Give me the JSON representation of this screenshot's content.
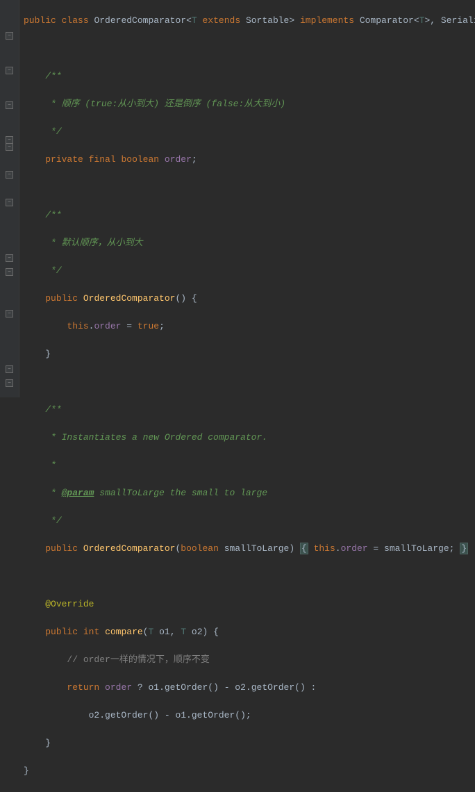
{
  "code": {
    "line1_public": "public",
    "line1_class": "class",
    "line1_classname": "OrderedComparator",
    "line1_lt": "<",
    "line1_generic": "T",
    "line1_extends": "extends",
    "line1_sortable": "Sortable",
    "line1_gt": ">",
    "line1_implements": "implements",
    "line1_comparator": "Comparator",
    "line1_lt2": "<",
    "line1_generic2": "T",
    "line1_gt2": ">",
    "line1_comma": ",",
    "line1_serializable": "Serializable",
    "line1_brace": "{",
    "doc1_open": "/**",
    "doc1_body": " * 顺序 (true:从小到大) 还是倒序 (false:从大到小)",
    "doc1_close": " */",
    "field_private": "private",
    "field_final": "final",
    "field_boolean": "boolean",
    "field_name": "order",
    "field_semi": ";",
    "doc2_open": "/**",
    "doc2_body": " * 默认顺序，从小到大",
    "doc2_close": " */",
    "ctor1_public": "public",
    "ctor1_name": "OrderedComparator",
    "ctor1_parens": "() {",
    "ctor1_this": "this",
    "ctor1_dot": ".",
    "ctor1_field": "order",
    "ctor1_eq": " = ",
    "ctor1_true": "true",
    "ctor1_semi": ";",
    "ctor1_close": "}",
    "doc3_open": "/**",
    "doc3_body1": " * Instantiates a new Ordered comparator.",
    "doc3_blank": " *",
    "doc3_param_prefix": " * ",
    "doc3_param_tag": "@param",
    "doc3_param_rest": " smallToLarge the small to large",
    "doc3_close": " */",
    "ctor2_public": "public",
    "ctor2_name": "OrderedComparator",
    "ctor2_open": "(",
    "ctor2_boolean": "boolean",
    "ctor2_param": "smallToLarge",
    "ctor2_close_paren": ") ",
    "ctor2_brace_open": "{",
    "ctor2_sp1": " ",
    "ctor2_this": "this",
    "ctor2_dot": ".",
    "ctor2_field": "order",
    "ctor2_eq": " = ",
    "ctor2_param2": "smallToLarge",
    "ctor2_semi": "; ",
    "ctor2_brace_close": "}",
    "override": "@Override",
    "cmp_public": "public",
    "cmp_int": "int",
    "cmp_name": "compare",
    "cmp_open": "(",
    "cmp_t1": "T",
    "cmp_o1": " o1",
    "cmp_comma": ", ",
    "cmp_t2": "T",
    "cmp_o2": " o2",
    "cmp_close_paren": ") {",
    "cmp_comment": "// order一样的情况下，顺序不变",
    "cmp_return": "return",
    "cmp_space": " ",
    "cmp_order": "order",
    "cmp_tern": " ? o1.",
    "cmp_getorder1": "getOrder",
    "cmp_mid1": "() - o2.",
    "cmp_getorder2": "getOrder",
    "cmp_end1": "() :",
    "cmp_line2_pre": "o2.",
    "cmp_getorder3": "getOrder",
    "cmp_mid2": "() - o1.",
    "cmp_getorder4": "getOrder",
    "cmp_end2": "();",
    "cmp_close": "}",
    "class_close": "}"
  },
  "indent": {
    "i1": "    ",
    "i2": "        ",
    "i3": "            "
  }
}
